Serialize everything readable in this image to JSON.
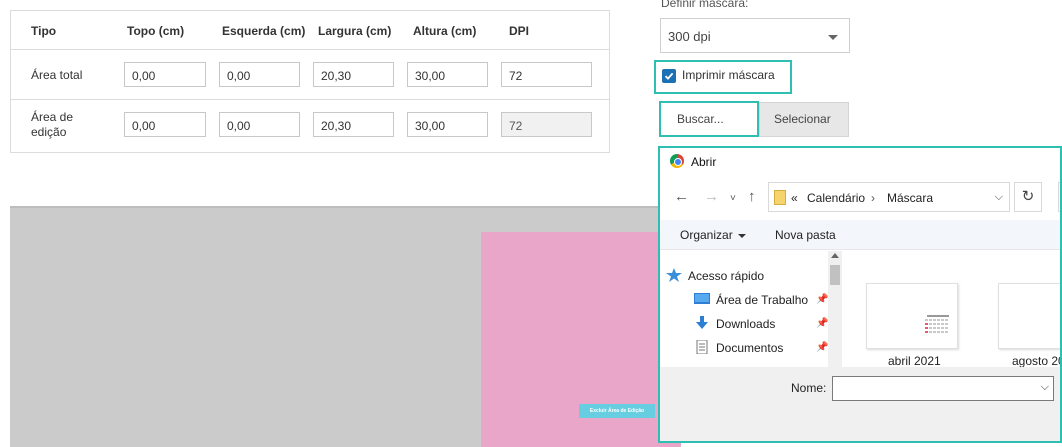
{
  "dimensions_table": {
    "headers": [
      "Tipo",
      "Topo (cm)",
      "Esquerda (cm)",
      "Largura (cm)",
      "Altura (cm)",
      "DPI"
    ],
    "rows": [
      {
        "label": "Área total",
        "topo": "0,00",
        "esquerda": "0,00",
        "largura": "20,30",
        "altura": "30,00",
        "dpi": "72"
      },
      {
        "label": "Área de edição",
        "label_line1": "Área de",
        "label_line2": "edição",
        "topo": "0,00",
        "esquerda": "0,00",
        "largura": "20,30",
        "altura": "30,00",
        "dpi": "72"
      }
    ]
  },
  "mask": {
    "label": "Definir máscara:",
    "selected": "300 dpi",
    "print_mask_label": "Imprimir máscara",
    "print_mask_checked": true,
    "buscar_label": "Buscar...",
    "selecionar_label": "Selecionar"
  },
  "canvas": {
    "delete_edit_area_label": "Excluir Área de Edição",
    "background_color": "#cbcbcb",
    "edit_area_color": "#e9a6c9"
  },
  "file_dialog": {
    "title": "Abrir",
    "breadcrumb": [
      "«",
      "Calendário",
      "Máscara"
    ],
    "organize_label": "Organizar",
    "new_folder_label": "Nova pasta",
    "nav_items": [
      "Acesso rápido",
      "Área de Trabalho",
      "Downloads",
      "Documentos"
    ],
    "files": [
      "abril 2021",
      "agosto 20"
    ],
    "name_label": "Nome:",
    "name_value": ""
  },
  "colors": {
    "accent_teal": "#2ebfb2",
    "checkbox_blue": "#1c70b4",
    "button_cyan": "#67cde0"
  }
}
